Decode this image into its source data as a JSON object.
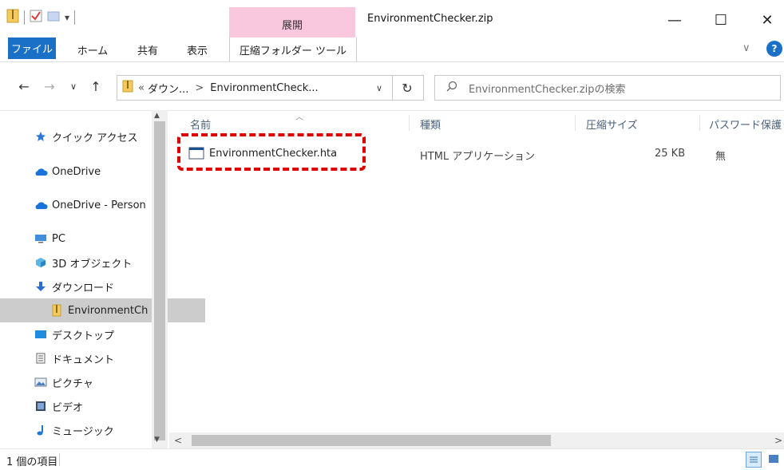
{
  "window": {
    "title": "EnvironmentChecker.zip",
    "context_tab_label": "展開",
    "minimize_glyph": "—",
    "maximize_glyph": "☐",
    "close_glyph": "✕"
  },
  "qat": {
    "dropdown_glyph": "▾"
  },
  "ribbon": {
    "tabs": [
      {
        "label": "ファイル"
      },
      {
        "label": "ホーム"
      },
      {
        "label": "共有"
      },
      {
        "label": "表示"
      },
      {
        "label": "圧縮フォルダー ツール"
      }
    ],
    "expand_glyph": "∨",
    "help_glyph": "?"
  },
  "nav": {
    "back_glyph": "←",
    "forward_glyph": "→",
    "recent_glyph": "∨",
    "up_glyph": "↑",
    "refresh_glyph": "↻"
  },
  "address": {
    "overflow": "«",
    "crumbs": [
      "ダウン...",
      "EnvironmentCheck..."
    ],
    "separator": ">",
    "dropdown_glyph": "∨"
  },
  "search": {
    "placeholder": "EnvironmentChecker.zipの検索"
  },
  "nav_pane": {
    "items": [
      {
        "label": "クイック アクセス",
        "icon": "star-icon"
      },
      {
        "label": "OneDrive",
        "icon": "cloud-icon"
      },
      {
        "label": "OneDrive - Person",
        "icon": "cloud-icon"
      },
      {
        "label": "PC",
        "icon": "pc-icon"
      },
      {
        "label": "3D オブジェクト",
        "icon": "cube-icon"
      },
      {
        "label": "ダウンロード",
        "icon": "download-icon"
      },
      {
        "label": "EnvironmentCh",
        "icon": "zip-folder-icon",
        "selected": true
      },
      {
        "label": "デスクトップ",
        "icon": "desktop-icon"
      },
      {
        "label": "ドキュメント",
        "icon": "document-icon"
      },
      {
        "label": "ピクチャ",
        "icon": "picture-icon"
      },
      {
        "label": "ビデオ",
        "icon": "video-icon"
      },
      {
        "label": "ミュージック",
        "icon": "music-icon"
      }
    ]
  },
  "columns": {
    "name": "名前",
    "type": "種類",
    "compressed_size": "圧縮サイズ",
    "password": "パスワード保護"
  },
  "files": [
    {
      "name": "EnvironmentChecker.hta",
      "type": "HTML アプリケーション",
      "size": "25 KB",
      "password": "無"
    }
  ],
  "status": {
    "item_count": "1 個の項目"
  },
  "colors": {
    "file_tab": "#1a6fc6",
    "context_tab": "#f9c7de",
    "selection": "#cce8ff",
    "highlight": "#e00000"
  }
}
